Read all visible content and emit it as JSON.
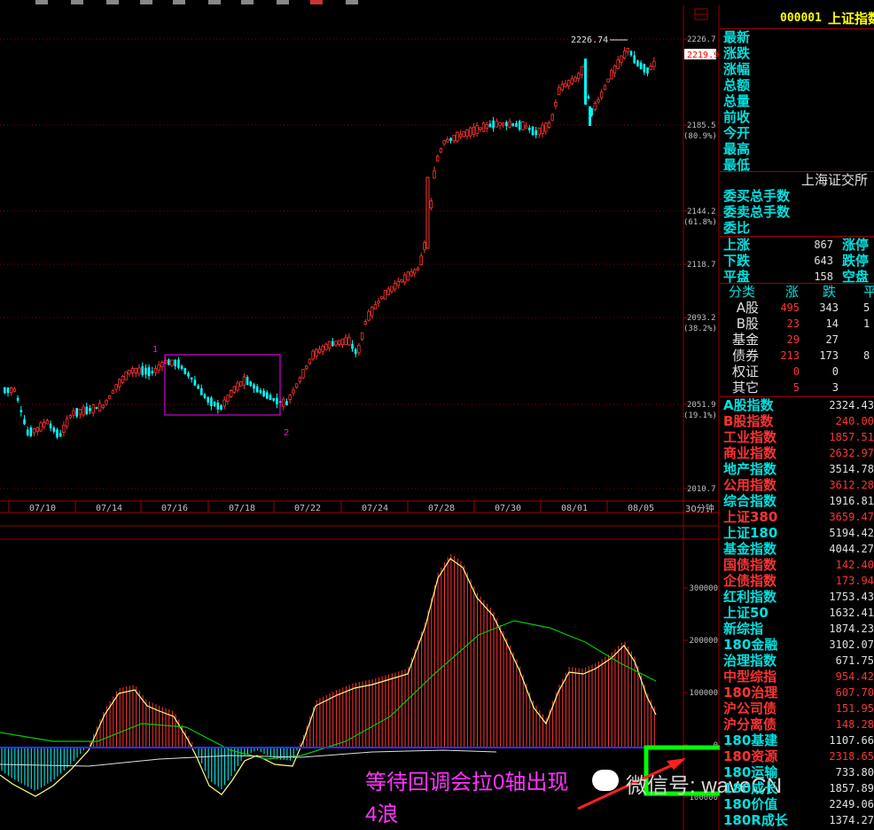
{
  "panel": {
    "code": "000001",
    "name": "上证指数",
    "quote_labels": [
      "最新",
      "涨跌",
      "涨幅",
      "总额",
      "总量",
      "前收",
      "今开",
      "最高",
      "最低"
    ],
    "exchange": "上海证交所",
    "order_labels": [
      "委买总手数",
      "委卖总手数",
      "委比"
    ],
    "breadth": [
      {
        "l": "上涨",
        "v": "867",
        "r": "涨停"
      },
      {
        "l": "下跌",
        "v": "643",
        "r": "跌停"
      },
      {
        "l": "平盘",
        "v": "158",
        "r": "空盘"
      }
    ],
    "cat_header": [
      "分类",
      "涨",
      "跌",
      "平"
    ],
    "cats": [
      {
        "n": "A股",
        "u": "495",
        "d": "343",
        "f": "5"
      },
      {
        "n": "B股",
        "u": "23",
        "d": "14",
        "f": "1"
      },
      {
        "n": "基金",
        "u": "29",
        "d": "27",
        "f": ""
      },
      {
        "n": "债券",
        "u": "213",
        "d": "173",
        "f": "8"
      },
      {
        "n": "权证",
        "u": "0",
        "d": "0",
        "f": ""
      },
      {
        "n": "其它",
        "u": "5",
        "d": "3",
        "f": ""
      }
    ],
    "indices": [
      {
        "n": "A股指数",
        "v": "2324.43",
        "c": "c"
      },
      {
        "n": "B股指数",
        "v": "240.00",
        "c": "r"
      },
      {
        "n": "工业指数",
        "v": "1857.51",
        "c": "r"
      },
      {
        "n": "商业指数",
        "v": "2632.97",
        "c": "r"
      },
      {
        "n": "地产指数",
        "v": "3514.78",
        "c": "c"
      },
      {
        "n": "公用指数",
        "v": "3612.28",
        "c": "r"
      },
      {
        "n": "综合指数",
        "v": "1916.81",
        "c": "c"
      },
      {
        "n": "上证380",
        "v": "3659.47",
        "c": "r"
      },
      {
        "n": "上证180",
        "v": "5194.42",
        "c": "c"
      },
      {
        "n": "基金指数",
        "v": "4044.27",
        "c": "c"
      },
      {
        "n": "国债指数",
        "v": "142.40",
        "c": "r"
      },
      {
        "n": "企债指数",
        "v": "173.94",
        "c": "r"
      },
      {
        "n": "红利指数",
        "v": "1753.43",
        "c": "c"
      },
      {
        "n": "上证50",
        "v": "1632.41",
        "c": "c"
      },
      {
        "n": "新综指",
        "v": "1874.23",
        "c": "c"
      },
      {
        "n": "180金融",
        "v": "3102.07",
        "c": "c"
      },
      {
        "n": "治理指数",
        "v": "671.75",
        "c": "c"
      },
      {
        "n": "中型综指",
        "v": "954.42",
        "c": "r"
      },
      {
        "n": "180治理",
        "v": "607.70",
        "c": "r"
      },
      {
        "n": "沪公司债",
        "v": "151.95",
        "c": "r"
      },
      {
        "n": "沪分离债",
        "v": "148.28",
        "c": "r"
      },
      {
        "n": "180基建",
        "v": "1107.66",
        "c": "c"
      },
      {
        "n": "180资源",
        "v": "2318.65",
        "c": "r"
      },
      {
        "n": "180运输",
        "v": "733.80",
        "c": "c"
      },
      {
        "n": "180成长",
        "v": "1857.89",
        "c": "c"
      },
      {
        "n": "180价值",
        "v": "2249.06",
        "c": "c"
      },
      {
        "n": "180R成长",
        "v": "1374.27",
        "c": "c"
      }
    ]
  },
  "price_axis": {
    "labels": [
      {
        "v": "2226.7",
        "pct": ""
      },
      {
        "v": "2185.5",
        "pct": "(80.9%)"
      },
      {
        "v": "2144.2",
        "pct": "(61.8%)"
      },
      {
        "v": "2118.7",
        "pct": ""
      },
      {
        "v": "2093.2",
        "pct": "(38.2%)"
      },
      {
        "v": "2051.9",
        "pct": "(19.1%)"
      },
      {
        "v": "2010.7",
        "pct": ""
      }
    ],
    "current": "2219.9",
    "high_label": "2226.74"
  },
  "time_axis": {
    "dates": [
      "07/10",
      "07/14",
      "07/16",
      "07/18",
      "07/22",
      "07/24",
      "07/28",
      "07/30",
      "08/01",
      "08/05"
    ],
    "period": "30分钟"
  },
  "macd_axis": [
    "300000",
    "200000",
    "100000",
    "0",
    "100000"
  ],
  "wave_marks": [
    "1",
    "2"
  ],
  "annotation": {
    "line1": "等待回调会拉0轴出现",
    "line2": "4浪"
  },
  "watermark": "微信号: waveCN",
  "colors": {
    "up": "#ff3333",
    "down": "#00ffff",
    "grid": "#a00000",
    "box": "#ff00ff",
    "dif": "#ffff80",
    "dea": "#00cc00",
    "green_box": "#00ff00"
  }
}
